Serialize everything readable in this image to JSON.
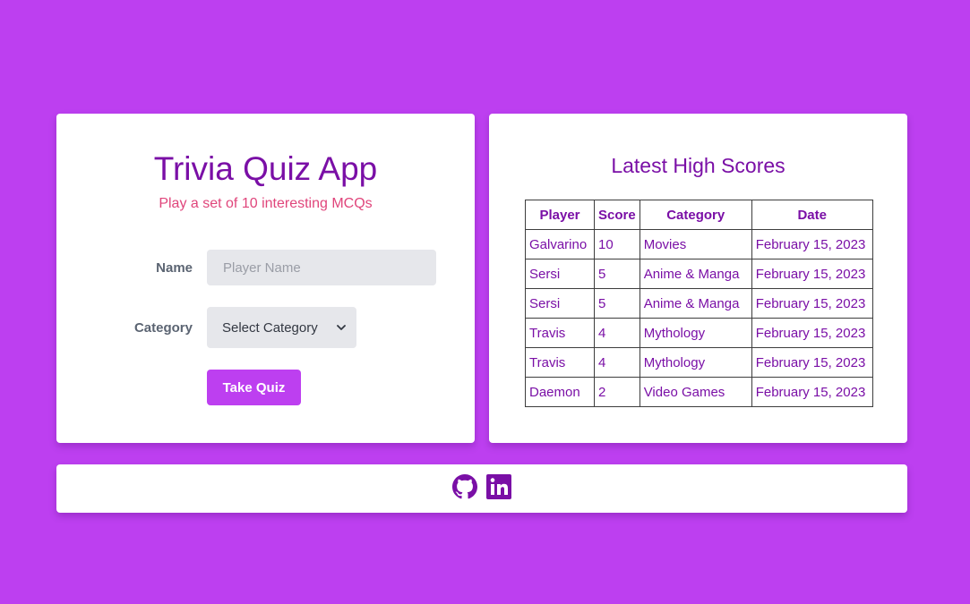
{
  "quiz": {
    "title": "Trivia Quiz App",
    "subtitle": "Play a set of 10 interesting MCQs",
    "name_label": "Name",
    "name_placeholder": "Player Name",
    "name_value": "",
    "category_label": "Category",
    "category_selected": "Select Category",
    "submit_label": "Take Quiz"
  },
  "scores": {
    "title": "Latest High Scores",
    "columns": [
      "Player",
      "Score",
      "Category",
      "Date"
    ],
    "rows": [
      [
        "Galvarino",
        "10",
        "Movies",
        "February 15, 2023"
      ],
      [
        "Sersi",
        "5",
        "Anime & Manga",
        "February 15, 2023"
      ],
      [
        "Sersi",
        "5",
        "Anime & Manga",
        "February 15, 2023"
      ],
      [
        "Travis",
        "4",
        "Mythology",
        "February 15, 2023"
      ],
      [
        "Travis",
        "4",
        "Mythology",
        "February 15, 2023"
      ],
      [
        "Daemon",
        "2",
        "Video Games",
        "February 15, 2023"
      ]
    ]
  },
  "footer": {
    "icons": [
      "github-icon",
      "linkedin-icon"
    ]
  },
  "colors": {
    "background": "#bd3ff0",
    "accent": "#7a0fa6",
    "subtitle": "#e0457b",
    "button": "#bd3ff0"
  }
}
